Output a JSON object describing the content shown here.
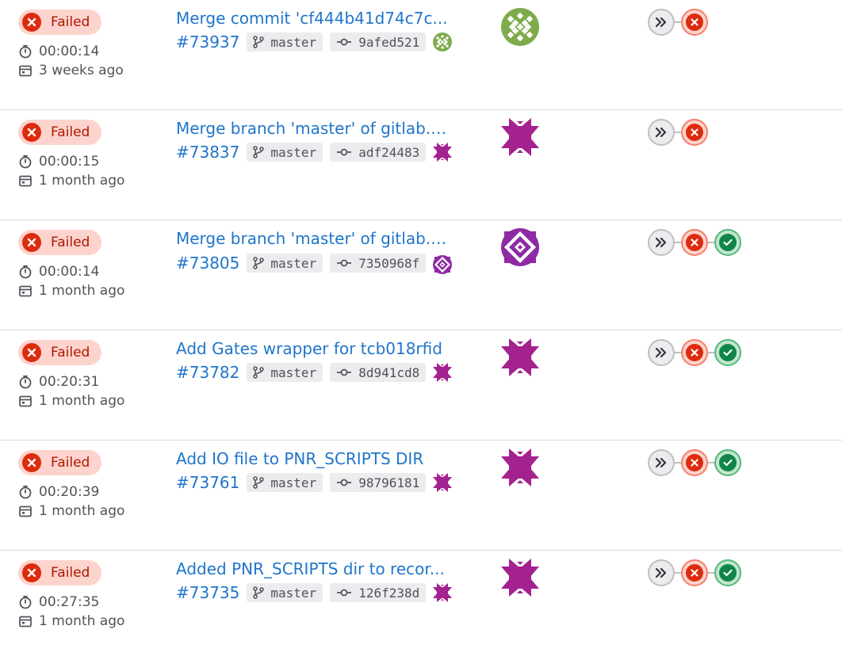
{
  "pipelines": [
    {
      "status": "Failed",
      "duration": "00:00:14",
      "finished": "3 weeks ago",
      "commit_title": "Merge commit 'cf444b41d74c7c...",
      "id": "#73937",
      "branch": "master",
      "sha": "9afed521",
      "avatar_color": "#7eab4b",
      "avatar_pattern": "lattice",
      "stages": [
        "skipped",
        "failed"
      ]
    },
    {
      "status": "Failed",
      "duration": "00:00:15",
      "finished": "1 month ago",
      "commit_title": "Merge branch 'master' of gitlab.a...",
      "id": "#73837",
      "branch": "master",
      "sha": "adf24483",
      "avatar_color": "#a3228f",
      "avatar_pattern": "star",
      "stages": [
        "skipped",
        "failed"
      ]
    },
    {
      "status": "Failed",
      "duration": "00:00:14",
      "finished": "1 month ago",
      "commit_title": "Merge branch 'master' of gitlab.a...",
      "id": "#73805",
      "branch": "master",
      "sha": "7350968f",
      "avatar_color": "#8e2aa3",
      "avatar_pattern": "diamond",
      "stages": [
        "skipped",
        "failed",
        "passed"
      ]
    },
    {
      "status": "Failed",
      "duration": "00:20:31",
      "finished": "1 month ago",
      "commit_title": "Add Gates wrapper for tcb018rfid",
      "id": "#73782",
      "branch": "master",
      "sha": "8d941cd8",
      "avatar_color": "#a3228f",
      "avatar_pattern": "star",
      "stages": [
        "skipped",
        "failed",
        "passed"
      ]
    },
    {
      "status": "Failed",
      "duration": "00:20:39",
      "finished": "1 month ago",
      "commit_title": "Add IO file to PNR_SCRIPTS DIR",
      "id": "#73761",
      "branch": "master",
      "sha": "98796181",
      "avatar_color": "#a3228f",
      "avatar_pattern": "star",
      "stages": [
        "skipped",
        "failed",
        "passed"
      ]
    },
    {
      "status": "Failed",
      "duration": "00:27:35",
      "finished": "1 month ago",
      "commit_title": "Added PNR_SCRIPTS dir to recor...",
      "id": "#73735",
      "branch": "master",
      "sha": "126f238d",
      "avatar_color": "#a3228f",
      "avatar_pattern": "star",
      "stages": [
        "skipped",
        "failed",
        "passed"
      ]
    }
  ],
  "colors": {
    "link": "#1f75cb",
    "failed_bg": "#fdd4cd",
    "failed": "#dd2b0e",
    "passed": "#108548"
  }
}
